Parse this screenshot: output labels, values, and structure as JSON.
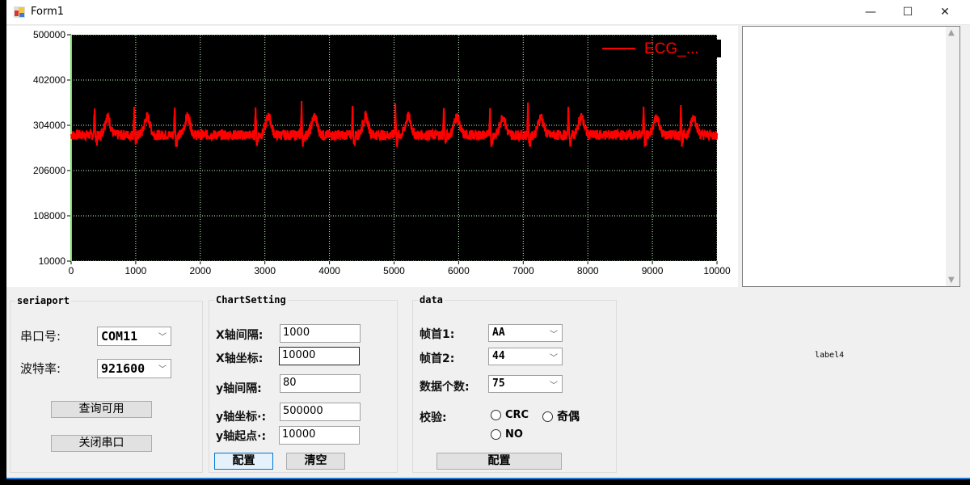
{
  "window": {
    "title": "Form1",
    "minimize": "—",
    "maximize": "☐",
    "close": "✕"
  },
  "chart_data": {
    "type": "line",
    "xlim": [
      0,
      10000
    ],
    "ylim": [
      10000,
      500000
    ],
    "x_ticks": [
      "0",
      "1000",
      "2000",
      "3000",
      "4000",
      "5000",
      "6000",
      "7000",
      "8000",
      "9000",
      "10000"
    ],
    "y_ticks": [
      "10000",
      "108000",
      "206000",
      "304000",
      "402000",
      "500000"
    ],
    "grid": true,
    "legend_placement": "top-right",
    "series": [
      {
        "name": "ECG_...",
        "color": "#ff0000",
        "baseline": 283000,
        "r_peak_value": 348000,
        "t_wave_value": 316000,
        "r_peak_x": [
          363,
          977,
          1603,
          2855,
          3568,
          4357,
          5020,
          5771,
          6485,
          7073,
          7700,
          8864,
          9440
        ]
      }
    ]
  },
  "seriaport": {
    "title": "seriaport",
    "port_label": "串口号:",
    "port_value": "COM11",
    "baud_label": "波特率:",
    "baud_value": "921600",
    "query_button": "查询可用",
    "close_button": "关闭串口"
  },
  "chartsetting": {
    "title": "ChartSetting",
    "x_interval_label": "X轴间隔:",
    "x_interval": "1000",
    "x_axis_label": "X轴坐标:",
    "x_axis": "10000",
    "y_interval_label": "y轴间隔:",
    "y_interval": "80",
    "y_axis_label": "y轴坐标·:",
    "y_axis": "500000",
    "y_start_label": "y轴起点·:",
    "y_start": "10000",
    "config_button": "配置",
    "clear_button": "清空"
  },
  "data": {
    "title": "data",
    "head1_label": "帧首1:",
    "head1": "AA",
    "head2_label": "帧首2:",
    "head2": "44",
    "count_label": "数据个数:",
    "count": "75",
    "check_label": "校验:",
    "crc": "CRC",
    "parity": "奇偶",
    "no": "NO",
    "config_button": "配置"
  },
  "label4": "label4"
}
